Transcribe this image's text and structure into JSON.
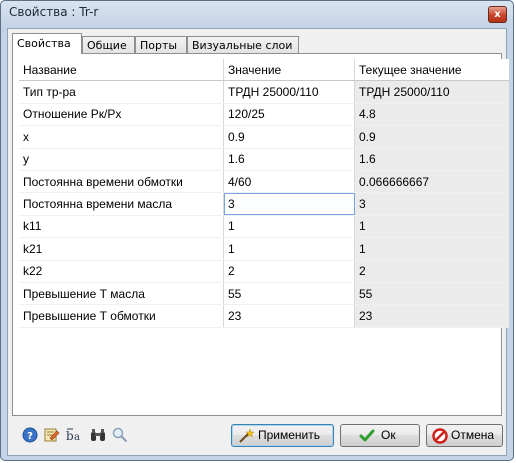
{
  "window": {
    "title": "Свойства :   Tr-r",
    "close_label": "x"
  },
  "tabs": [
    {
      "label": "Свойства",
      "active": true
    },
    {
      "label": "Общие",
      "active": false
    },
    {
      "label": "Порты",
      "active": false
    },
    {
      "label": "Визуальные слои",
      "active": false
    }
  ],
  "grid": {
    "headers": [
      "Название",
      "Значение",
      "Текущее значение"
    ],
    "rows": [
      {
        "name": "Тип тр-ра",
        "value": "ТРДН 25000/110",
        "current": "ТРДН 25000/110"
      },
      {
        "name": "Отношение Рк/Рх",
        "value": "120/25",
        "current": "4.8"
      },
      {
        "name": "x",
        "value": "0.9",
        "current": "0.9"
      },
      {
        "name": "y",
        "value": "1.6",
        "current": "1.6"
      },
      {
        "name": "Постоянна времени обмотки",
        "value": "4/60",
        "current": "0.066666667"
      },
      {
        "name": "Постоянна времени масла",
        "value": "3",
        "current": "3"
      },
      {
        "name": "k11",
        "value": "1",
        "current": "1"
      },
      {
        "name": "k21",
        "value": "1",
        "current": "1"
      },
      {
        "name": "k22",
        "value": "2",
        "current": "2"
      },
      {
        "name": "Превышение Т масла",
        "value": "55",
        "current": "55"
      },
      {
        "name": "Превышение Т обмотки",
        "value": "23",
        "current": "23"
      }
    ]
  },
  "toolbar_icons": [
    "help-icon",
    "notes-icon",
    "font-size-icon",
    "binoculars-icon",
    "magnifier-icon"
  ],
  "buttons": {
    "apply": "Применить",
    "ok": "Ок",
    "cancel": "Отмена"
  },
  "colors": {
    "title_bar": "#c4d3e6",
    "close_button": "#c9432b",
    "ok_check": "#2e9e2e",
    "cancel_icon": "#d0201a",
    "apply_default_border": "#3c7fb1"
  }
}
